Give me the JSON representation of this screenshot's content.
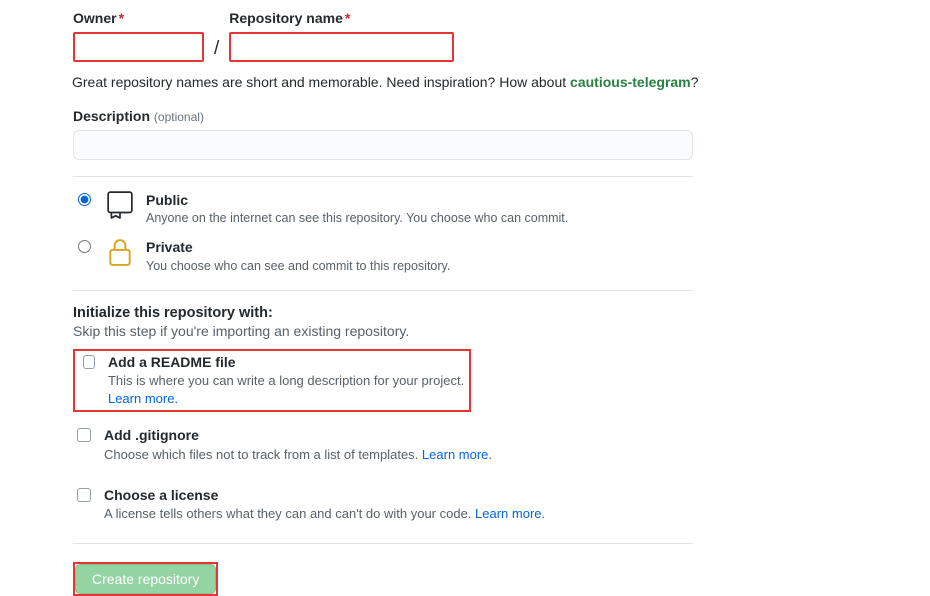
{
  "owner": {
    "label": "Owner",
    "value": ""
  },
  "repo": {
    "label": "Repository name",
    "value": ""
  },
  "slash": "/",
  "hint": {
    "prefix": "Great repository names are short and memorable. Need inspiration? How about ",
    "suggestion": "cautious-telegram",
    "suffix": "?"
  },
  "description": {
    "label": "Description ",
    "optional": "(optional)",
    "value": ""
  },
  "visibility": {
    "public": {
      "title": "Public",
      "sub": "Anyone on the internet can see this repository. You choose who can commit."
    },
    "private": {
      "title": "Private",
      "sub": "You choose who can see and commit to this repository."
    }
  },
  "init": {
    "heading": "Initialize this repository with:",
    "sub": "Skip this step if you're importing an existing repository."
  },
  "readme": {
    "title": "Add a README file",
    "sub": "This is where you can write a long description for your project. ",
    "learn": "Learn more."
  },
  "gitignore": {
    "title": "Add .gitignore",
    "sub": "Choose which files not to track from a list of templates. ",
    "learn": "Learn more."
  },
  "license": {
    "title": "Choose a license",
    "sub": "A license tells others what they can and can't do with your code. ",
    "learn": "Learn more."
  },
  "submit": {
    "label": "Create repository"
  }
}
